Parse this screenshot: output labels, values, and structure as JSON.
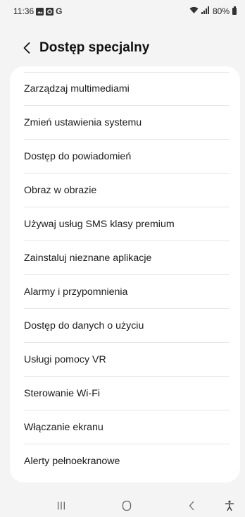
{
  "status_bar": {
    "time": "11:36",
    "notification_icons": [
      "image-notification-icon",
      "calendar-notification-icon",
      "google-icon"
    ],
    "google_letter": "G",
    "battery": "80%"
  },
  "header": {
    "title": "Dostęp specjalny"
  },
  "items": [
    {
      "label": "Zarządzaj multimediami"
    },
    {
      "label": "Zmień ustawienia systemu"
    },
    {
      "label": "Dostęp do powiadomień"
    },
    {
      "label": "Obraz w obrazie"
    },
    {
      "label": "Używaj usług SMS klasy premium"
    },
    {
      "label": "Zainstaluj nieznane aplikacje"
    },
    {
      "label": "Alarmy i przypomnienia"
    },
    {
      "label": "Dostęp do danych o użyciu"
    },
    {
      "label": "Usługi pomocy VR"
    },
    {
      "label": "Sterowanie Wi-Fi"
    },
    {
      "label": "Włączanie ekranu"
    },
    {
      "label": "Alerty pełnoekranowe"
    }
  ],
  "navigation": [
    "recents-icon",
    "home-icon",
    "back-icon",
    "accessibility-icon"
  ]
}
